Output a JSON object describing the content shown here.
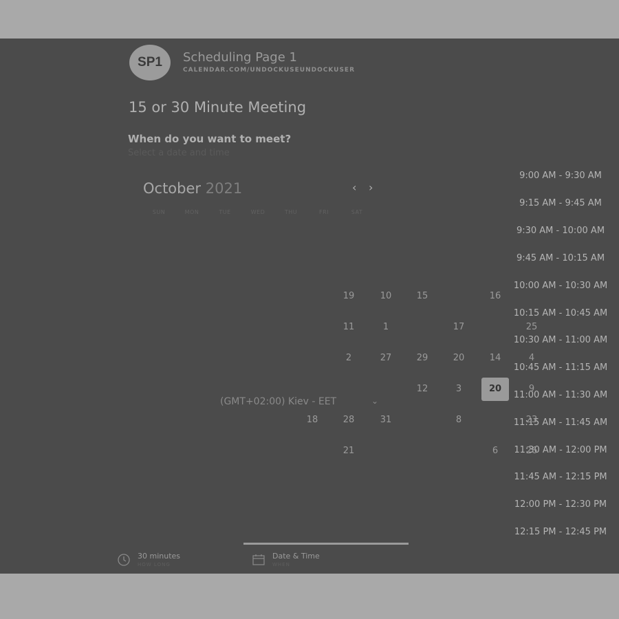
{
  "header": {
    "avatar_initials": "SP1",
    "page_name": "Scheduling Page 1",
    "page_url": "CALENDAR.COM/UNDOCKUSEUNDOCKUSER"
  },
  "meeting": {
    "title": "15 or 30 Minute Meeting",
    "question": "When do you want to meet?",
    "subtitle": "Select a date and time"
  },
  "calendar": {
    "month": "October",
    "year": "2021",
    "weekdays": [
      "SUN",
      "MON",
      "TUE",
      "WED",
      "THU",
      "FRI",
      "SAT"
    ],
    "days": {
      "d19": "19",
      "d10": "10",
      "d15": "15",
      "d16": "16",
      "d11": "11",
      "d1": "1",
      "d17": "17",
      "d25": "25",
      "d2": "2",
      "d27": "27",
      "d29": "29",
      "d20": "20",
      "d14": "14",
      "d4": "4",
      "d12": "12",
      "d3": "3",
      "d20sel": "20",
      "d9": "9",
      "d18": "18",
      "d28": "28",
      "d31": "31",
      "d8": "8",
      "d23": "23",
      "d21": "21",
      "d6": "6",
      "d26": "26"
    },
    "selected_day": "20",
    "timezone": "(GMT+02:00) Kiev - EET"
  },
  "slots": [
    "9:00 AM - 9:30 AM",
    "9:15 AM - 9:45 AM",
    "9:30 AM - 10:00 AM",
    "9:45 AM - 10:15 AM",
    "10:00 AM - 10:30 AM",
    "10:15 AM - 10:45 AM",
    "10:30 AM - 11:00 AM",
    "10:45 AM - 11:15 AM",
    "11:00 AM - 11:30 AM",
    "11:15 AM - 11:45 AM",
    "11:30 AM - 12:00 PM",
    "11:45 AM - 12:15 PM",
    "12:00 PM - 12:30 PM",
    "12:15 PM - 12:45 PM"
  ],
  "footer": {
    "duration_label": "30 minutes",
    "duration_sub": "HOW LONG",
    "datetime_label": "Date & Time",
    "datetime_sub": "WHEN"
  },
  "icons": {
    "prev": "chevron-left-icon",
    "next": "chevron-right-icon",
    "clock": "clock-icon",
    "calendar": "calendar-icon",
    "dropdown": "chevron-down-icon"
  },
  "colors": {
    "overlay": "#4b4b4b",
    "outside": "#a9a9a9",
    "selected": "#9a9a9a"
  }
}
